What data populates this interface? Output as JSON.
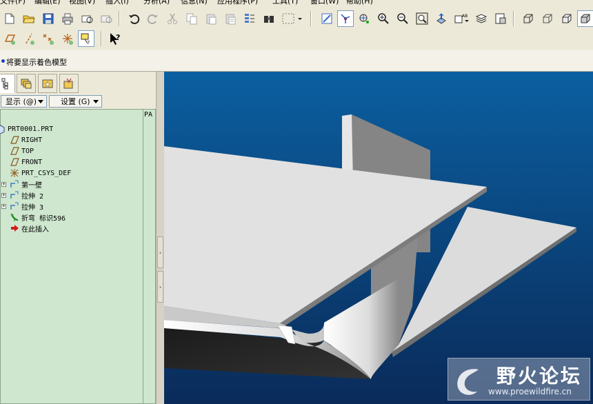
{
  "menu": [
    "文件(F)",
    "编辑(E)",
    "视图(V)",
    "插入(I)",
    "分析(A)",
    "信息(N)",
    "应用程序(P)",
    "工具(T)",
    "窗口(W)",
    "帮助(H)"
  ],
  "toolbar": {
    "row1_icons": [
      "new-icon",
      "open-icon",
      "save-icon",
      "print-icon",
      "send-mail-icon",
      "send-link-icon",
      "undo-icon",
      "redo-icon",
      "cut-icon",
      "copy-icon",
      "paste-icon",
      "paste-special-icon",
      "regenerate-icon",
      "find-icon",
      "select-box-icon",
      "repaint-icon",
      "spin-center-icon",
      "orient-icon",
      "zoom-in-icon",
      "zoom-out-icon",
      "refit-icon",
      "reorient-icon",
      "saved-views-icon",
      "layers-icon",
      "view-manager-icon",
      "wireframe-icon",
      "hidden-line-icon",
      "no-hidden-icon",
      "shading-icon"
    ],
    "row2_icons": [
      "datum-plane-icon",
      "datum-axis-icon",
      "datum-point-icon",
      "coord-sys-icon",
      "annotation-icon",
      "whats-this-icon"
    ]
  },
  "message": "将要显示着色模型",
  "navigator": {
    "tabs": [
      "model-tree-tab",
      "folder-browser-tab",
      "favorites-tab",
      "connections-tab"
    ],
    "show_label": "显示 (@)",
    "settings_label": "设置 (G)",
    "column_header": "PA",
    "tree": [
      {
        "label": "PRT0001.PRT",
        "icon": "part-icon",
        "level": 0,
        "expandable": false
      },
      {
        "label": "RIGHT",
        "icon": "datum-plane-icon",
        "level": 1,
        "expandable": false
      },
      {
        "label": "TOP",
        "icon": "datum-plane-icon",
        "level": 1,
        "expandable": false
      },
      {
        "label": "FRONT",
        "icon": "datum-plane-icon",
        "level": 1,
        "expandable": false
      },
      {
        "label": "PRT_CSYS_DEF",
        "icon": "coord-sys-icon",
        "level": 1,
        "expandable": false
      },
      {
        "label": "第一壁",
        "icon": "sheetmetal-wall-icon",
        "level": 1,
        "expandable": true
      },
      {
        "label": "拉伸 2",
        "icon": "extrude-icon",
        "level": 1,
        "expandable": true
      },
      {
        "label": "拉伸 3",
        "icon": "extrude-icon",
        "level": 1,
        "expandable": true
      },
      {
        "label": "折弯 标识596",
        "icon": "bend-icon",
        "level": 1,
        "expandable": false
      },
      {
        "label": "在此插入",
        "icon": "insert-here-icon",
        "level": 1,
        "expandable": false
      }
    ]
  },
  "watermark": {
    "title": "野火论坛",
    "url": "www.proewildfire.cn"
  },
  "colors": {
    "viewport_top": "#0b5fa0",
    "viewport_bottom": "#0a2b5a",
    "tree_bg": "#cfe7cf"
  }
}
